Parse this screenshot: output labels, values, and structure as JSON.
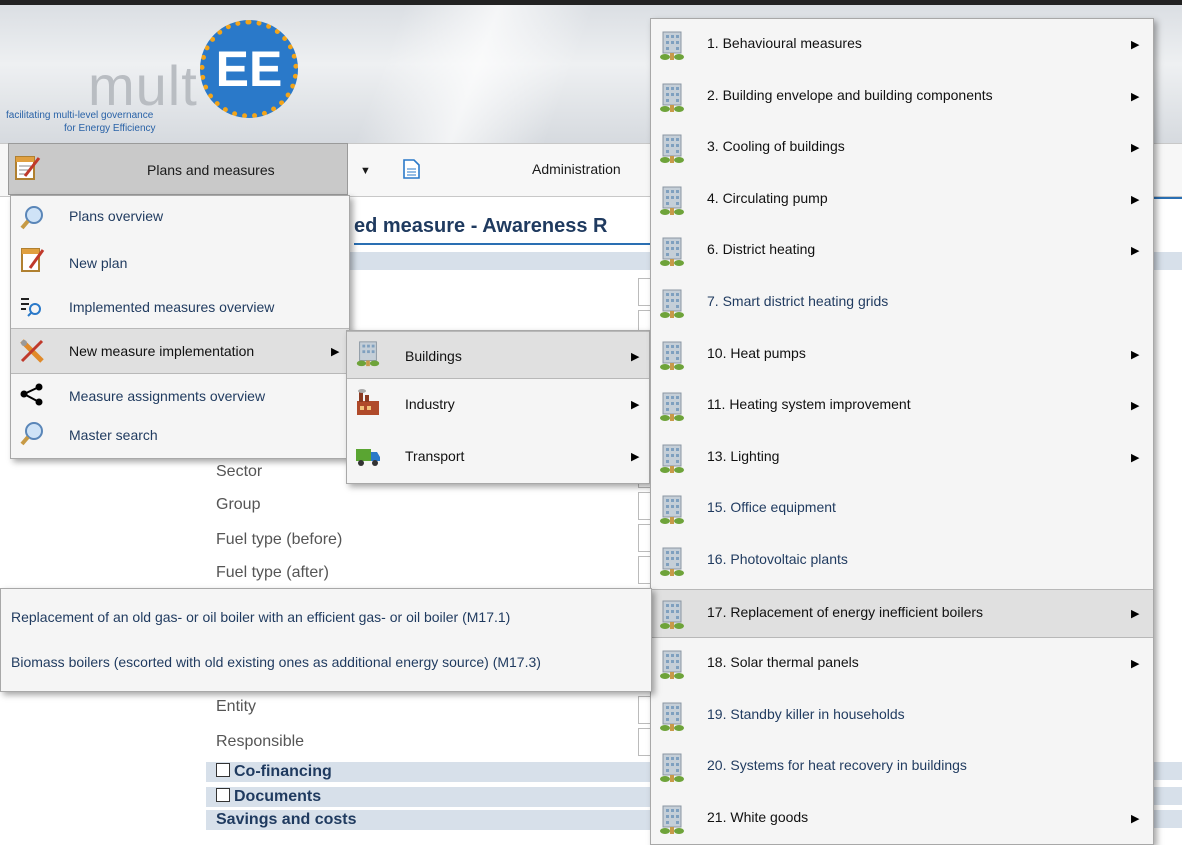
{
  "logo": {
    "brand_text": "mult",
    "brand_badge": "EE",
    "tagline_line1": "facilitating multi-level governance",
    "tagline_line2": "for Energy Efficiency"
  },
  "menubar": {
    "plans_label": "Plans and measures",
    "admin_label": "Administration"
  },
  "page": {
    "title": "ed measure - Awareness R",
    "fields": [
      "Sector",
      "Group",
      "Fuel type (before)",
      "Fuel type (after)",
      "Entity",
      "Responsible"
    ],
    "sections": {
      "cofinancing": "Co-financing",
      "documents": "Documents",
      "savings": "Savings and costs"
    }
  },
  "plans_menu": {
    "items": [
      {
        "label": "Plans overview",
        "icon": "magnifier-icon"
      },
      {
        "label": "New plan",
        "icon": "notepad-icon"
      },
      {
        "label": "Implemented measures overview",
        "icon": "list-search-icon"
      },
      {
        "label": "New measure implementation",
        "icon": "tools-icon",
        "has_submenu": true,
        "highlighted": true
      },
      {
        "label": "Measure assignments overview",
        "icon": "share-icon"
      },
      {
        "label": "Master search",
        "icon": "magnifier-icon"
      }
    ]
  },
  "sector_menu": {
    "items": [
      {
        "label": "Buildings",
        "icon": "building-icon",
        "highlighted": true
      },
      {
        "label": "Industry",
        "icon": "factory-icon"
      },
      {
        "label": "Transport",
        "icon": "truck-icon"
      }
    ]
  },
  "buildings_menu": {
    "items": [
      {
        "label": "1. Behavioural measures",
        "has_submenu": true
      },
      {
        "label": "2. Building envelope and building components",
        "has_submenu": true
      },
      {
        "label": "3. Cooling of buildings",
        "has_submenu": true
      },
      {
        "label": "4. Circulating pump",
        "has_submenu": true
      },
      {
        "label": "6. District heating",
        "has_submenu": true
      },
      {
        "label": "7. Smart district heating grids",
        "has_submenu": false
      },
      {
        "label": "10. Heat pumps",
        "has_submenu": true
      },
      {
        "label": "11. Heating system improvement",
        "has_submenu": true
      },
      {
        "label": "13. Lighting",
        "has_submenu": true
      },
      {
        "label": "15. Office equipment",
        "has_submenu": false
      },
      {
        "label": "16. Photovoltaic plants",
        "has_submenu": false
      },
      {
        "label": "17. Replacement of energy inefficient boilers",
        "has_submenu": true,
        "highlighted": true
      },
      {
        "label": "18. Solar thermal panels",
        "has_submenu": true
      },
      {
        "label": "19. Standby killer in households",
        "has_submenu": false
      },
      {
        "label": "20. Systems for heat recovery in buildings",
        "has_submenu": false
      },
      {
        "label": "21. White goods",
        "has_submenu": true
      }
    ]
  },
  "boiler_menu": {
    "items": [
      {
        "label": "Replacement of an old gas- or oil boiler with an efficient gas- or oil boiler (M17.1)"
      },
      {
        "label": "Biomass boilers (escorted with old existing ones as additional energy source) (M17.3)"
      }
    ]
  }
}
